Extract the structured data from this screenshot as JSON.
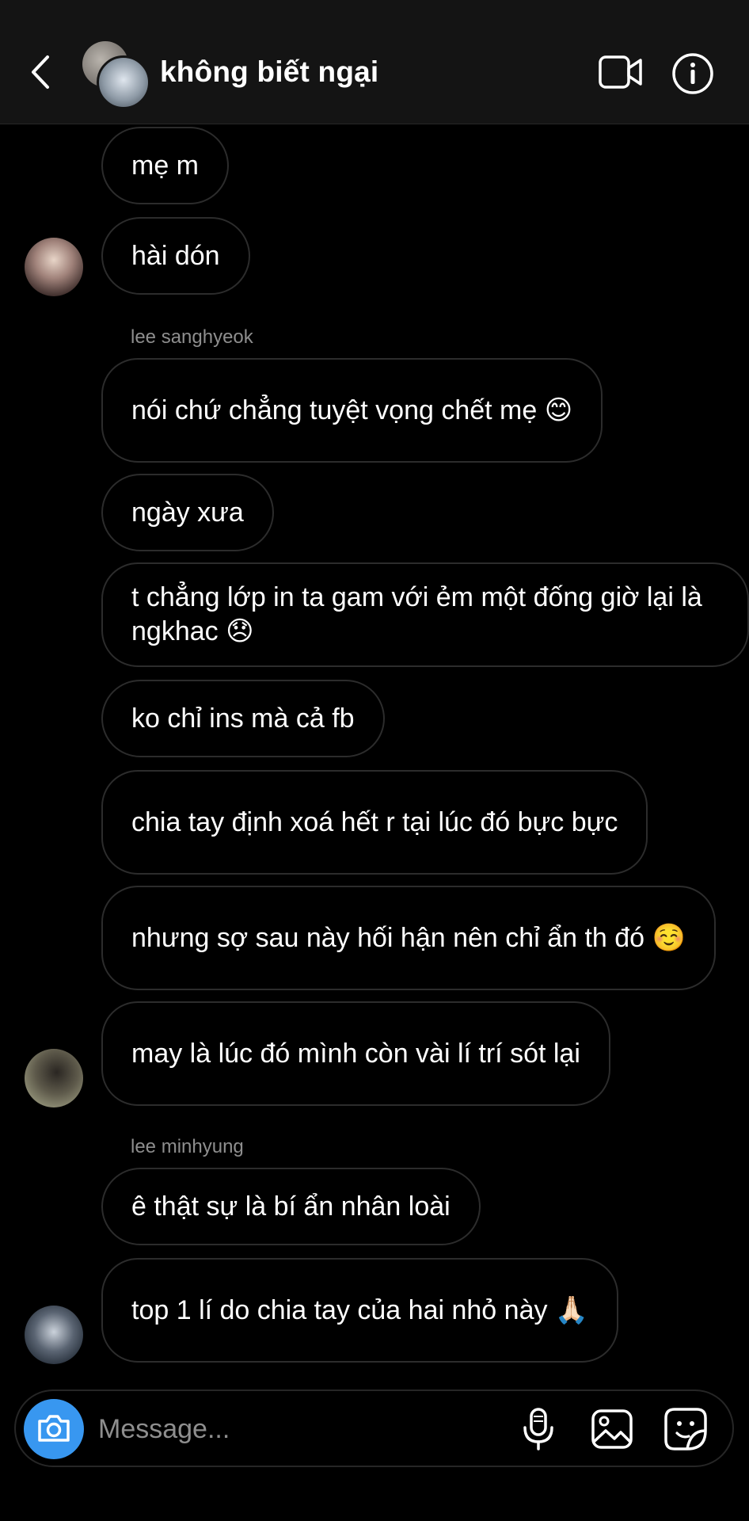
{
  "header": {
    "title": "không biết ngại",
    "back_icon": "chevron-left-icon",
    "video_icon": "video-camera-icon",
    "info_icon": "info-icon"
  },
  "messages": [
    {
      "text": "mẹ m"
    },
    {
      "text": "hài dón"
    },
    {
      "sender": "lee sanghyeok"
    },
    {
      "text": "nói chứ chẳng tuyệt vọng chết mẹ 😊"
    },
    {
      "text": "ngày xưa"
    },
    {
      "text": "t chẳng lớp in ta gam với ẻm một đống giờ lại là ngkhac 😞"
    },
    {
      "text": "ko chỉ ins mà cả fb"
    },
    {
      "text": "chia tay định xoá hết r tại lúc đó bực bực"
    },
    {
      "text": "nhưng sợ sau này hối hận nên chỉ ẩn th đó ☺️"
    },
    {
      "text": "may là lúc đó mình còn vài lí trí sót lại"
    },
    {
      "sender": "lee minhyung"
    },
    {
      "text": "ê thật sự là bí ẩn nhân loài"
    },
    {
      "text": "top 1 lí do chia tay của hai nhỏ này 🙏🏻"
    }
  ],
  "composer": {
    "placeholder": "Message...",
    "camera_icon": "camera-icon",
    "mic_icon": "microphone-icon",
    "gallery_icon": "gallery-icon",
    "sticker_icon": "sticker-icon",
    "camera_button_color": "#3897f0"
  }
}
